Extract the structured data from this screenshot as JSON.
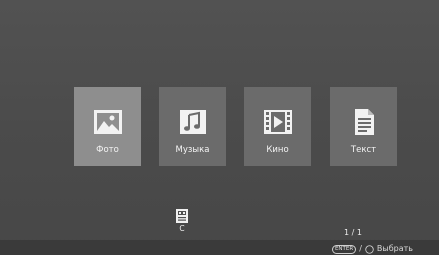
{
  "menu": {
    "items": [
      {
        "label": "Фото",
        "icon": "photo-icon",
        "selected": true
      },
      {
        "label": "Музыка",
        "icon": "music-note-icon",
        "selected": false
      },
      {
        "label": "Кино",
        "icon": "film-icon",
        "selected": false
      },
      {
        "label": "Текст",
        "icon": "text-document-icon",
        "selected": false
      }
    ]
  },
  "device": {
    "label": "C",
    "icon": "usb-drive-icon"
  },
  "page_counter": "1 / 1",
  "hint": {
    "enter_key": "ENTER",
    "separator": "/",
    "select_label": "Выбрать",
    "select_icon": "ok-circle-icon"
  },
  "colors": {
    "background": "#4e4e4e",
    "tile": "#6b6b6b",
    "tile_selected": "#8e8e8e",
    "text": "#f2f2f2",
    "bottom_bar": "#3a3a3a"
  }
}
